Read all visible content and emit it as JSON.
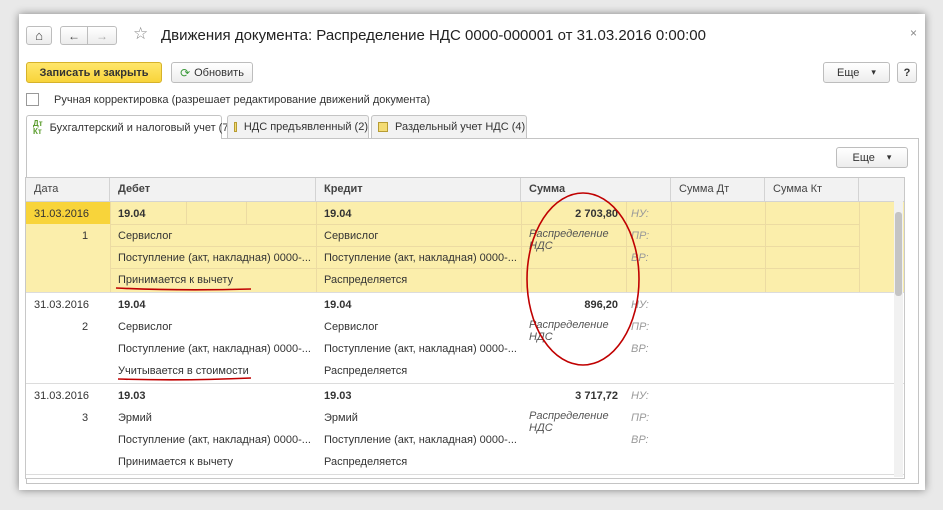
{
  "window": {
    "title": "Движения документа: Распределение НДС 0000-000001 от 31.03.2016 0:00:00",
    "close_glyph": "×"
  },
  "toolbar": {
    "home_glyph": "⌂",
    "back_glyph": "←",
    "forward_glyph": "→",
    "favorite_glyph": "☆",
    "save_close_label": "Записать и закрыть",
    "refresh_label": "Обновить",
    "refresh_glyph": "⟳",
    "more_label": "Еще",
    "more_glyph": "▾",
    "help_label": "?"
  },
  "manual_edit": {
    "label": "Ручная корректировка (разрешает редактирование движений документа)",
    "checked": false
  },
  "tabs": [
    {
      "label": "Бухгалтерский и налоговый учет (7)",
      "icon": "dt-kt-icon",
      "active": true
    },
    {
      "label": "НДС предъявленный (2)",
      "icon": "register-icon",
      "active": false
    },
    {
      "label": "Раздельный учет НДС (4)",
      "icon": "register-icon",
      "active": false
    }
  ],
  "grid": {
    "more_label": "Еще",
    "headers": [
      "Дата",
      "Дебет",
      "Кредит",
      "Сумма",
      "Сумма Дт",
      "Сумма Кт"
    ],
    "records": [
      {
        "date": "31.03.2016",
        "num": "1",
        "debit": [
          "19.04",
          "Сервислог",
          "Поступление (акт, накладная) 0000-...",
          "Принимается к вычету"
        ],
        "credit": [
          "19.04",
          "Сервислог",
          "Поступление (акт, накладная) 0000-...",
          "Распределяется"
        ],
        "amount": "2 703,80",
        "content": [
          "Распределение",
          "НДС"
        ],
        "accounts": [
          "НУ:",
          "ПР:",
          "ВР:"
        ],
        "selected": true
      },
      {
        "date": "31.03.2016",
        "num": "2",
        "debit": [
          "19.04",
          "Сервислог",
          "Поступление (акт, накладная) 0000-...",
          "Учитывается в стоимости"
        ],
        "credit": [
          "19.04",
          "Сервислог",
          "Поступление (акт, накладная) 0000-...",
          "Распределяется"
        ],
        "amount": "896,20",
        "content": [
          "Распределение",
          "НДС"
        ],
        "accounts": [
          "НУ:",
          "ПР:",
          "ВР:"
        ],
        "selected": false
      },
      {
        "date": "31.03.2016",
        "num": "3",
        "debit": [
          "19.03",
          "Эрмий",
          "Поступление (акт, накладная) 0000-...",
          "Принимается к вычету"
        ],
        "credit": [
          "19.03",
          "Эрмий",
          "Поступление (акт, накладная) 0000-...",
          "Распределяется"
        ],
        "amount": "3 717,72",
        "content": [
          "Распределение",
          "НДС"
        ],
        "accounts": [
          "НУ:",
          "ПР:",
          "ВР:"
        ],
        "selected": false
      }
    ]
  },
  "annotations": {
    "color": "#c00000"
  }
}
